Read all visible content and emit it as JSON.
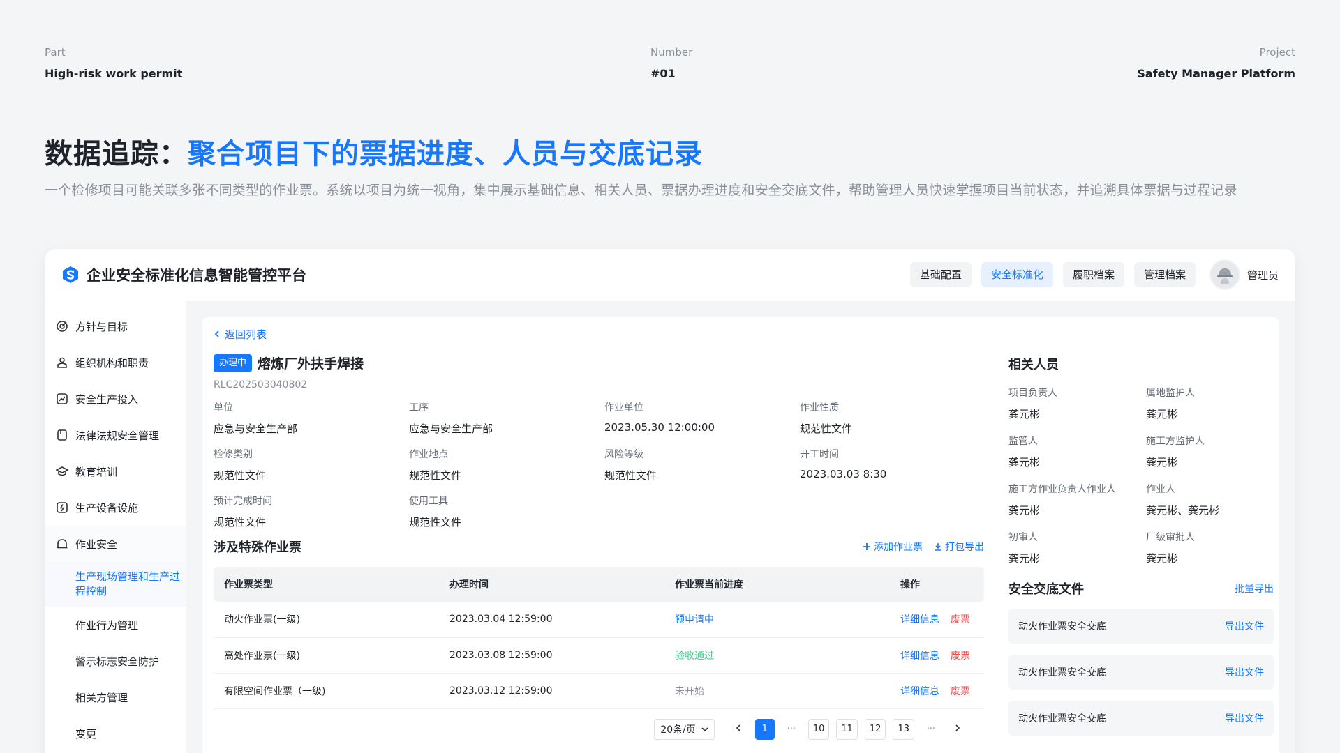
{
  "meta": {
    "part_label": "Part",
    "part_value": "High-risk work permit",
    "number_label": "Number",
    "number_value": "#01",
    "project_label": "Project",
    "project_value": "Safety Manager Platform"
  },
  "headline": {
    "prefix": "数据追踪：",
    "highlight": "聚合项目下的票据进度、人员与交底记录"
  },
  "subtitle": "一个检修项目可能关联多张不同类型的作业票。系统以项目为统一视角，集中展示基础信息、相关人员、票据办理进度和安全交底文件，帮助管理人员快速掌握项目当前状态，并追溯具体票据与过程记录",
  "app": {
    "title": "企业安全标准化信息智能管控平台",
    "nav": [
      "基础配置",
      "安全标准化",
      "履职档案",
      "管理档案"
    ],
    "nav_active_index": 1,
    "user_name": "管理员"
  },
  "sidebar": {
    "items": [
      {
        "label": "方针与目标",
        "icon": "target-icon"
      },
      {
        "label": "组织机构和职责",
        "icon": "person-icon"
      },
      {
        "label": "安全生产投入",
        "icon": "chart-icon"
      },
      {
        "label": "法律法规安全管理",
        "icon": "book-icon"
      },
      {
        "label": "教育培训",
        "icon": "graduation-icon"
      },
      {
        "label": "生产设备设施",
        "icon": "power-icon"
      },
      {
        "label": "作业安全",
        "icon": "helmet-icon"
      }
    ],
    "sub_items": [
      "生产现场管理和生产过程控制",
      "作业行为管理",
      "警示标志安全防护",
      "相关方管理",
      "变更"
    ],
    "sub_active_index": 0
  },
  "detail": {
    "back_label": "返回列表",
    "status_tag": "办理中",
    "title": "熔炼厂外扶手焊接",
    "code": "RLC202503040802",
    "info": [
      {
        "label": "单位",
        "value": "应急与安全生产部"
      },
      {
        "label": "工序",
        "value": "应急与安全生产部"
      },
      {
        "label": "作业单位",
        "value": "2023.05.30 12:00:00"
      },
      {
        "label": "作业性质",
        "value": "规范性文件"
      },
      {
        "label": "检修类别",
        "value": "规范性文件"
      },
      {
        "label": "作业地点",
        "value": "规范性文件"
      },
      {
        "label": "风险等级",
        "value": "规范性文件"
      },
      {
        "label": "开工时间",
        "value": "2023.03.03 8:30"
      },
      {
        "label": "预计完成时间",
        "value": "规范性文件"
      },
      {
        "label": "使用工具",
        "value": "规范性文件"
      }
    ]
  },
  "tickets": {
    "section_title": "涉及特殊作业票",
    "add_label": "添加作业票",
    "export_label": "打包导出",
    "columns": [
      "作业票类型",
      "办理时间",
      "作业票当前进度",
      "操作"
    ],
    "rows": [
      {
        "type": "动火作业票(一级)",
        "time": "2023.03.04 12:59:00",
        "status": "预申请中",
        "status_color": "#1677ff",
        "op_detail": "详细信息",
        "op_void": "废票"
      },
      {
        "type": "高处作业票(一级)",
        "time": "2023.03.08 12:59:00",
        "status": "验收通过",
        "status_color": "#3cc88c",
        "op_detail": "详细信息",
        "op_void": "废票"
      },
      {
        "type": "有限空间作业票（一级)",
        "time": "2023.03.12 12:59:00",
        "status": "未开始",
        "status_color": "#8a8f99",
        "op_detail": "详细信息",
        "op_void": "废票"
      }
    ],
    "pagination": {
      "page_size": "20条/页",
      "pages": [
        "1",
        "···",
        "10",
        "11",
        "12",
        "13",
        "···"
      ],
      "active_page": "1"
    }
  },
  "people": {
    "title": "相关人员",
    "list": [
      {
        "label": "项目负责人",
        "value": "龚元彬"
      },
      {
        "label": "属地监护人",
        "value": "龚元彬"
      },
      {
        "label": "监管人",
        "value": "龚元彬"
      },
      {
        "label": "施工方监护人",
        "value": "龚元彬"
      },
      {
        "label": "施工方作业负责人作业人",
        "value": "龚元彬"
      },
      {
        "label": "作业人",
        "value": "龚元彬、龚元彬"
      },
      {
        "label": "初审人",
        "value": "龚元彬"
      },
      {
        "label": "厂级审批人",
        "value": "龚元彬"
      }
    ]
  },
  "files": {
    "title": "安全交底文件",
    "batch_export": "批量导出",
    "list": [
      {
        "name": "动火作业票安全交底",
        "action": "导出文件"
      },
      {
        "name": "动火作业票安全交底",
        "action": "导出文件"
      },
      {
        "name": "动火作业票安全交底",
        "action": "导出文件"
      }
    ]
  },
  "colors": {
    "accent": "#1677ff",
    "success": "#3cc88c",
    "danger": "#f04848",
    "muted": "#8a8f99"
  }
}
